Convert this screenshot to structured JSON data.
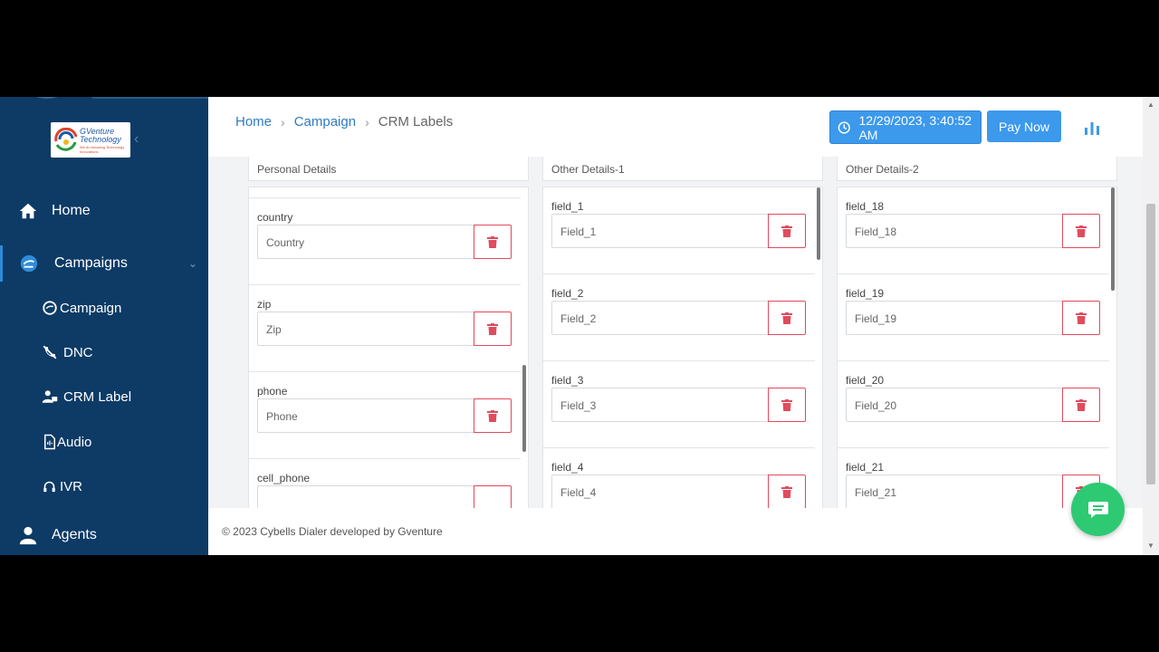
{
  "sidebar": {
    "logo": {
      "line1": "GVenture",
      "line2": "Technology",
      "tagline": "We do Amazing Technology Innovations"
    },
    "nav": [
      {
        "label": "Home",
        "icon": "home-icon"
      },
      {
        "label": "Campaigns",
        "icon": "campaigns-icon"
      },
      {
        "label": "Agents",
        "icon": "user-icon"
      }
    ],
    "sub": [
      {
        "label": "Campaign",
        "icon": "campaign-icon"
      },
      {
        "label": "DNC",
        "icon": "phone-slash-icon"
      },
      {
        "label": "CRM Label",
        "icon": "user-tag-icon"
      },
      {
        "label": "Audio",
        "icon": "audio-file-icon"
      },
      {
        "label": "IVR",
        "icon": "headphones-icon"
      }
    ]
  },
  "header": {
    "breadcrumb": {
      "home": "Home",
      "campaign": "Campaign",
      "current": "CRM Labels"
    },
    "datetime": "12/29/2023, 3:40:52 AM",
    "pay_label": "Pay Now"
  },
  "columns": [
    {
      "title": "Personal Details",
      "fields": [
        {
          "name": "country",
          "placeholder": "Country"
        },
        {
          "name": "zip",
          "placeholder": "Zip"
        },
        {
          "name": "phone",
          "placeholder": "Phone"
        },
        {
          "name": "cell_phone",
          "placeholder": ""
        }
      ]
    },
    {
      "title": "Other Details-1",
      "fields": [
        {
          "name": "field_1",
          "placeholder": "Field_1"
        },
        {
          "name": "field_2",
          "placeholder": "Field_2"
        },
        {
          "name": "field_3",
          "placeholder": "Field_3"
        },
        {
          "name": "field_4",
          "placeholder": "Field_4"
        }
      ]
    },
    {
      "title": "Other Details-2",
      "fields": [
        {
          "name": "field_18",
          "placeholder": "Field_18"
        },
        {
          "name": "field_19",
          "placeholder": "Field_19"
        },
        {
          "name": "field_20",
          "placeholder": "Field_20"
        },
        {
          "name": "field_21",
          "placeholder": "Field_21"
        }
      ]
    }
  ],
  "footer": {
    "text": "© 2023 Cybells Dialer developed by Gventure"
  },
  "colors": {
    "sidebar": "#0d3b66",
    "accent": "#3c99ec",
    "delete": "#e04b5d",
    "chat": "#2dca73"
  }
}
